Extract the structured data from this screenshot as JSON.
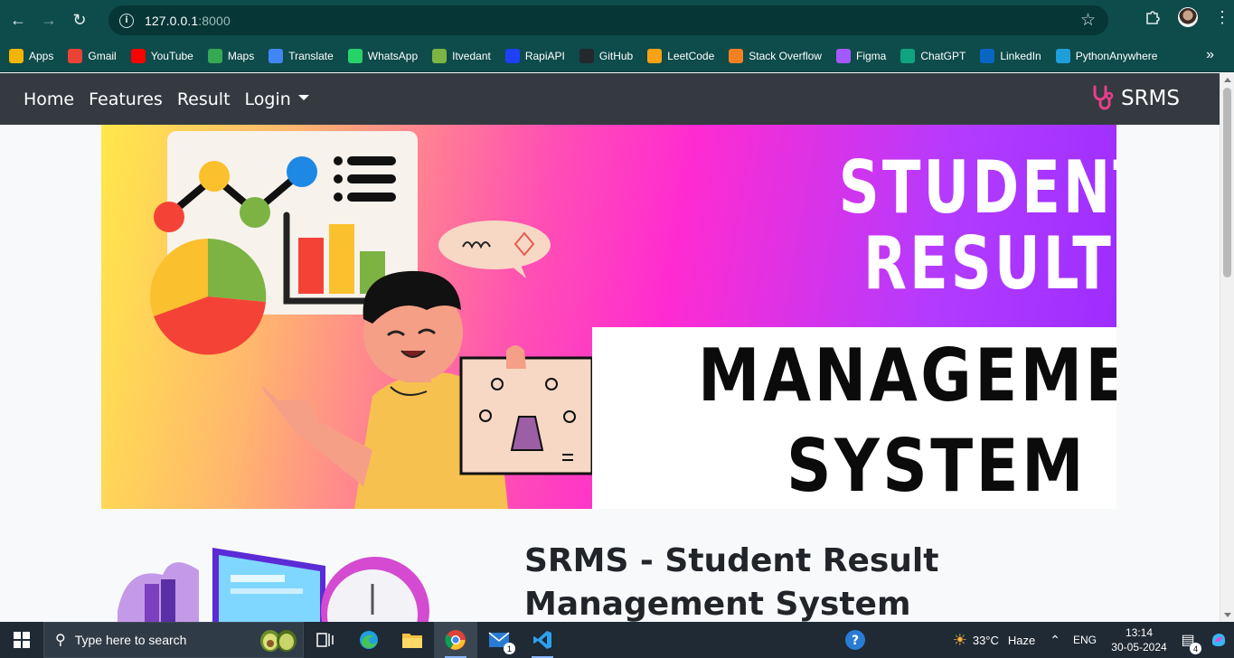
{
  "browser": {
    "url_host": "127.0.0.1",
    "url_port": ":8000",
    "bookmarks": [
      {
        "label": "Apps",
        "icon": "apps-grid-icon",
        "color": "#f4b400"
      },
      {
        "label": "Gmail",
        "icon": "gmail-icon",
        "color": "#ea4335"
      },
      {
        "label": "YouTube",
        "icon": "youtube-icon",
        "color": "#ff0000"
      },
      {
        "label": "Maps",
        "icon": "maps-icon",
        "color": "#34a853"
      },
      {
        "label": "Translate",
        "icon": "translate-icon",
        "color": "#4285f4"
      },
      {
        "label": "WhatsApp",
        "icon": "whatsapp-icon",
        "color": "#25d366"
      },
      {
        "label": "Itvedant",
        "icon": "itvedant-icon",
        "color": "#7cb342"
      },
      {
        "label": "RapiAPI",
        "icon": "rapidapi-icon",
        "color": "#1e40ff"
      },
      {
        "label": "GitHub",
        "icon": "github-icon",
        "color": "#24292e"
      },
      {
        "label": "LeetCode",
        "icon": "leetcode-icon",
        "color": "#ffa116"
      },
      {
        "label": "Stack Overflow",
        "icon": "stackoverflow-icon",
        "color": "#f48024"
      },
      {
        "label": "Figma",
        "icon": "figma-icon",
        "color": "#a259ff"
      },
      {
        "label": "ChatGPT",
        "icon": "chatgpt-icon",
        "color": "#10a37f"
      },
      {
        "label": "LinkedIn",
        "icon": "linkedin-icon",
        "color": "#0a66c2"
      },
      {
        "label": "PythonAnywhere",
        "icon": "pythonanywhere-icon",
        "color": "#1d9fd9"
      }
    ]
  },
  "navbar": {
    "links": [
      "Home",
      "Features",
      "Result",
      "Login"
    ],
    "brand": "SRMS",
    "brand_color": "#e83e8c"
  },
  "hero": {
    "line1": "STUDENT",
    "line2": "RESULT",
    "line3": "MANAGEMENT",
    "line4": "SYSTEM"
  },
  "section": {
    "title": "SRMS - Student Result Management System"
  },
  "taskbar": {
    "search_placeholder": "Type here to search",
    "weather_temp": "33°C",
    "weather_desc": "Haze",
    "language": "ENG",
    "time": "13:14",
    "date": "30-05-2024",
    "mail_badge": "1",
    "notification_badge": "4"
  }
}
